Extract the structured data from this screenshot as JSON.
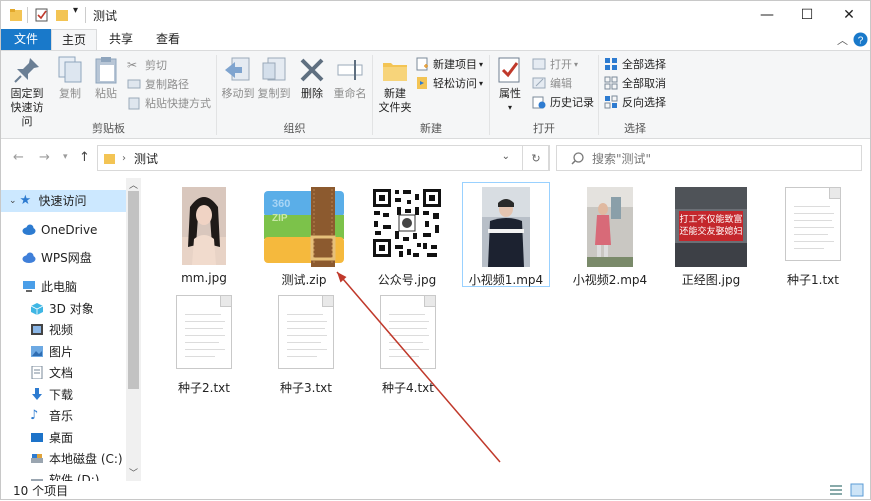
{
  "window": {
    "title": "测试"
  },
  "tabs": {
    "file": "文件",
    "home": "主页",
    "share": "共享",
    "view": "查看"
  },
  "ribbon": {
    "pin": "固定到\n快速访问",
    "pin1": "固定到",
    "pin2": "快速访问",
    "copy": "复制",
    "paste": "粘贴",
    "cut": "剪切",
    "copy_path": "复制路径",
    "paste_shortcut": "粘贴快捷方式",
    "clipboard_label": "剪贴板",
    "move_to": "移动到",
    "copy_to": "复制到",
    "delete": "删除",
    "rename": "重命名",
    "organize_label": "组织",
    "new_folder1": "新建",
    "new_folder2": "文件夹",
    "new_item": "新建项目",
    "easy_access": "轻松访问",
    "new_label": "新建",
    "properties": "属性",
    "open": "打开",
    "edit": "编辑",
    "history": "历史记录",
    "open_label": "打开",
    "select_all": "全部选择",
    "select_none": "全部取消",
    "invert": "反向选择",
    "select_label": "选择"
  },
  "address": {
    "path": "测试",
    "search_placeholder": "搜索\"测试\""
  },
  "navpane": [
    {
      "label": "快速访问",
      "icon": "star-icon"
    },
    {
      "label": "OneDrive",
      "icon": "cloud-icon"
    },
    {
      "label": "WPS网盘",
      "icon": "cloud-icon"
    },
    {
      "label": "此电脑",
      "icon": "pc-icon"
    },
    {
      "label": "3D 对象",
      "icon": "cube-icon"
    },
    {
      "label": "视频",
      "icon": "video-icon"
    },
    {
      "label": "图片",
      "icon": "picture-icon"
    },
    {
      "label": "文档",
      "icon": "document-icon"
    },
    {
      "label": "下载",
      "icon": "download-icon"
    },
    {
      "label": "音乐",
      "icon": "music-icon"
    },
    {
      "label": "桌面",
      "icon": "desktop-icon"
    },
    {
      "label": "本地磁盘 (C:)",
      "icon": "drive-icon"
    },
    {
      "label": "软件 (D:)",
      "icon": "drive-icon"
    }
  ],
  "files": [
    {
      "name": "mm.jpg"
    },
    {
      "name": "测试.zip"
    },
    {
      "name": "公众号.jpg"
    },
    {
      "name": "小视频1.mp4"
    },
    {
      "name": "小视频2.mp4"
    },
    {
      "name": "正经图.jpg",
      "banner1": "打工不仅能致富",
      "banner2": "还能交友娶媳妇"
    },
    {
      "name": "种子1.txt"
    },
    {
      "name": "种子2.txt"
    },
    {
      "name": "种子3.txt"
    },
    {
      "name": "种子4.txt"
    }
  ],
  "status": {
    "count": "10 个项目"
  },
  "colors": {
    "accent": "#1979ca",
    "selection": "#cce8ff",
    "arrow": "#c0392b"
  }
}
